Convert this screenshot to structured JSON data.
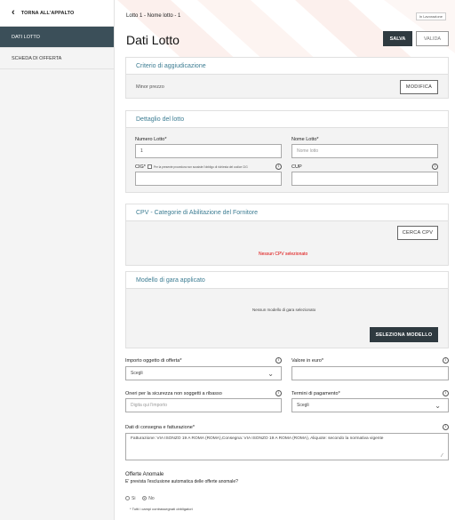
{
  "sidebar": {
    "back_label": "TORNA ALL'APPALTO",
    "items": [
      {
        "label": "DATI LOTTO",
        "active": true
      },
      {
        "label": "SCHEDA DI OFFERTA",
        "active": false
      }
    ]
  },
  "header": {
    "breadcrumb": "Lotto 1 - Nome lotto - 1",
    "status": "In Lavorazione",
    "title": "Dati Lotto",
    "save_label": "SALVA",
    "valida_label": "VALIDA"
  },
  "criterio": {
    "title": "Criterio di aggiudicazione",
    "value": "Minor prezzo",
    "button": "MODIFICA"
  },
  "dettaglio": {
    "title": "Dettaglio del lotto",
    "numero_label": "Numero Lotto*",
    "numero_value": "1",
    "nome_label": "Nome Lotto*",
    "nome_placeholder": "Nome lotto",
    "cig_label": "CIG*",
    "cig_note": "Per la presente procedura non sussiste l'obbligo di richiesta del codice CIG",
    "cup_label": "CUP"
  },
  "cpv": {
    "title": "CPV - Categorie di Abilitazione del Fornitore",
    "button": "CERCA CPV",
    "empty_message": "Nessun CPV selezionato"
  },
  "modello": {
    "title": "Modello di gara applicato",
    "empty_message": "Nessun modello di gara selezionato",
    "button": "SELEZIONA MODELLO"
  },
  "form": {
    "importo_label": "Importo oggetto di offerta*",
    "importo_value": "Scegli",
    "valore_label": "Valore in euro*",
    "oneri_label": "Oneri per la sicurezza non soggetti a ribasso",
    "oneri_placeholder": "Digita qui l'importo",
    "termini_label": "Termini di pagamento*",
    "termini_value": "Scegli",
    "consegna_label": "Dati di consegna e fatturazione*",
    "consegna_value": "Fatturazione: VIA ISONZO 19 A ROMA (ROMA),Consegna: VIA ISONZO 19 A ROMA (ROMA),  Aliquote: secondo la normativa vigente",
    "anomale_title": "Offerte Anomale",
    "anomale_question": "E' prevista l'esclusione automatica delle offerte anomale?",
    "radio_si": "Si",
    "radio_no": "No",
    "footnote": "* Tutti i campi contrassegnati obbligatori"
  },
  "icons": {
    "back": "chevron-left-icon",
    "info": "info-icon",
    "select": "chevron-down-icon",
    "resize": "resize-handle-icon"
  },
  "colors": {
    "sidebar_active": "#3b4f59",
    "primary_button": "#2f3a40",
    "section_title": "#3d7d93",
    "error_text": "#dd0000"
  }
}
